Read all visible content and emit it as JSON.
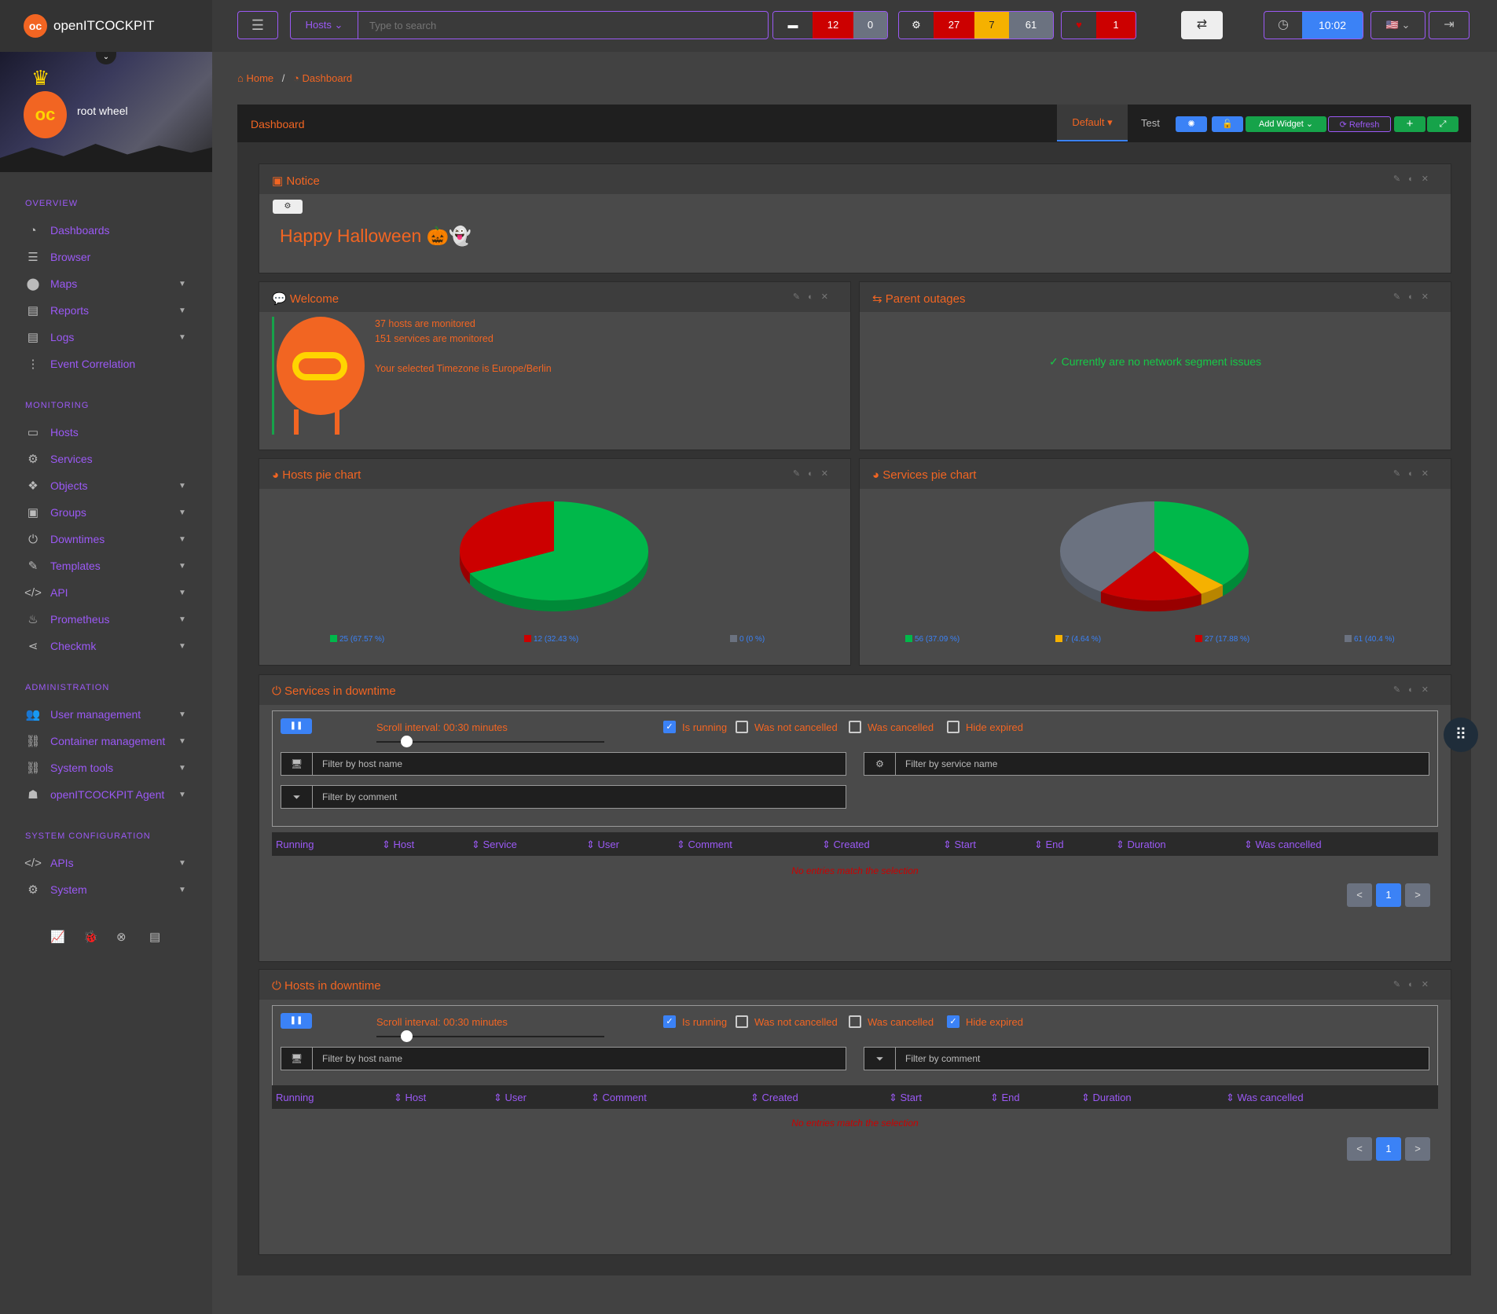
{
  "brand": {
    "name": "openITCOCKPIT"
  },
  "profile": {
    "user": "root wheel"
  },
  "sidebar": {
    "sections": [
      {
        "title": "OVERVIEW",
        "items": [
          {
            "label": "Dashboards",
            "icon": "dashboard-icon",
            "expand": false
          },
          {
            "label": "Browser",
            "icon": "list-icon",
            "expand": false
          },
          {
            "label": "Maps",
            "icon": "map-marker-icon",
            "expand": true
          },
          {
            "label": "Reports",
            "icon": "file-icon",
            "expand": true
          },
          {
            "label": "Logs",
            "icon": "file-text-icon",
            "expand": true
          },
          {
            "label": "Event Correlation",
            "icon": "sitemap-icon",
            "expand": false
          }
        ]
      },
      {
        "title": "MONITORING",
        "items": [
          {
            "label": "Hosts",
            "icon": "desktop-icon",
            "expand": false
          },
          {
            "label": "Services",
            "icon": "gears-icon",
            "expand": false
          },
          {
            "label": "Objects",
            "icon": "cubes-icon",
            "expand": true
          },
          {
            "label": "Groups",
            "icon": "object-group-icon",
            "expand": true
          },
          {
            "label": "Downtimes",
            "icon": "power-icon",
            "expand": true
          },
          {
            "label": "Templates",
            "icon": "edit-icon",
            "expand": true
          },
          {
            "label": "API",
            "icon": "code-icon",
            "expand": true
          },
          {
            "label": "Prometheus",
            "icon": "fire-icon",
            "expand": true
          },
          {
            "label": "Checkmk",
            "icon": "share-icon",
            "expand": true
          }
        ]
      },
      {
        "title": "ADMINISTRATION",
        "items": [
          {
            "label": "User management",
            "icon": "users-icon",
            "expand": true
          },
          {
            "label": "Container management",
            "icon": "link-icon",
            "expand": true
          },
          {
            "label": "System tools",
            "icon": "link-icon",
            "expand": true
          },
          {
            "label": "openITCOCKPIT Agent",
            "icon": "user-secret-icon",
            "expand": true
          }
        ]
      },
      {
        "title": "SYSTEM CONFIGURATION",
        "items": [
          {
            "label": "APIs",
            "icon": "code-icon",
            "expand": true
          },
          {
            "label": "System",
            "icon": "gears-icon",
            "expand": true
          }
        ]
      }
    ]
  },
  "topbar": {
    "search_type": "Hosts",
    "search_placeholder": "Type to search",
    "host_stats": {
      "down": "12",
      "unreachable": "0"
    },
    "service_stats": {
      "critical": "27",
      "warning": "7",
      "unknown": "61"
    },
    "cve_stats": {
      "count": "1"
    },
    "clock": "10:02"
  },
  "breadcrumb": {
    "home": "Home",
    "current": "Dashboard"
  },
  "dashboard": {
    "title": "Dashboard",
    "tabs": [
      "Default",
      "Test"
    ],
    "add_widget": "Add Widget",
    "refresh": "Refresh"
  },
  "widgets": {
    "notice": {
      "title": "Notice",
      "message": "Happy Halloween 🎃👻"
    },
    "welcome": {
      "title": "Welcome",
      "hosts": "37 hosts are monitored",
      "services": "151 services are monitored",
      "timezone": "Your selected Timezone is Europe/Berlin"
    },
    "parent": {
      "title": "Parent outages",
      "message": "Currently are no network segment issues"
    },
    "hostpie": {
      "title": "Hosts pie chart"
    },
    "svcpie": {
      "title": "Services pie chart"
    },
    "svcdown": {
      "title": "Services in downtime",
      "scroll": "Scroll interval: 00:30 minutes",
      "checks": [
        {
          "label": "Is running",
          "checked": true
        },
        {
          "label": "Was not cancelled",
          "checked": false
        },
        {
          "label": "Was cancelled",
          "checked": false
        },
        {
          "label": "Hide expired",
          "checked": false
        }
      ],
      "filter_host": "Filter by host name",
      "filter_service": "Filter by service name",
      "filter_comment": "Filter by comment",
      "columns": [
        "Running",
        "Host",
        "Service",
        "User",
        "Comment",
        "Created",
        "Start",
        "End",
        "Duration",
        "Was cancelled"
      ],
      "empty": "No entries match the selection",
      "page": "1"
    },
    "hostdown": {
      "title": "Hosts in downtime",
      "scroll": "Scroll interval: 00:30 minutes",
      "checks": [
        {
          "label": "Is running",
          "checked": true
        },
        {
          "label": "Was not cancelled",
          "checked": false
        },
        {
          "label": "Was cancelled",
          "checked": false
        },
        {
          "label": "Hide expired",
          "checked": true
        }
      ],
      "filter_host": "Filter by host name",
      "filter_comment": "Filter by comment",
      "columns": [
        "Running",
        "Host",
        "User",
        "Comment",
        "Created",
        "Start",
        "End",
        "Duration",
        "Was cancelled"
      ],
      "empty": "No entries match the selection",
      "page": "1"
    }
  },
  "chart_data": [
    {
      "type": "pie",
      "title": "Hosts pie chart",
      "categories": [
        "25 (67.57 %)",
        "12 (32.43 %)",
        "0 (0 %)"
      ],
      "values": [
        25,
        12,
        0
      ],
      "colors": [
        "#00b84a",
        "#cc0000",
        "#6b7280"
      ]
    },
    {
      "type": "pie",
      "title": "Services pie chart",
      "categories": [
        "56 (37.09 %)",
        "7 (4.64 %)",
        "27 (17.88 %)",
        "61 (40.4 %)"
      ],
      "values": [
        56,
        7,
        27,
        61
      ],
      "colors": [
        "#00b84a",
        "#f5b100",
        "#cc0000",
        "#6b7280"
      ]
    }
  ]
}
